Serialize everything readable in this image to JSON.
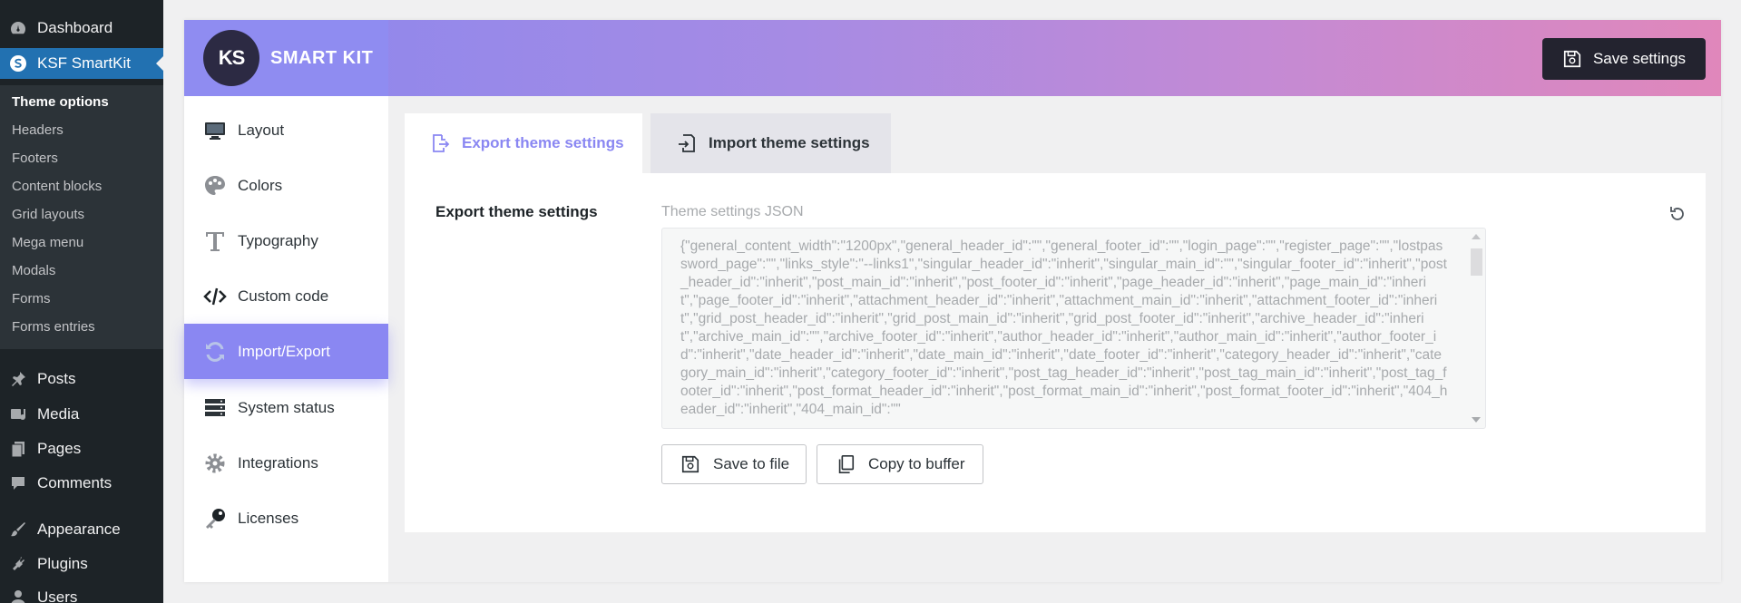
{
  "wp_menu": {
    "dashboard": "Dashboard",
    "smartkit": "KSF SmartKit",
    "submenu": [
      "Theme options",
      "Headers",
      "Footers",
      "Content blocks",
      "Grid layouts",
      "Mega menu",
      "Modals",
      "Forms",
      "Forms entries"
    ],
    "posts": "Posts",
    "media": "Media",
    "pages": "Pages",
    "comments": "Comments",
    "appearance": "Appearance",
    "plugins": "Plugins",
    "users": "Users"
  },
  "brand": {
    "logo": "KS",
    "name": "SMART KIT"
  },
  "header": {
    "save_label": "Save settings"
  },
  "nav": {
    "items": [
      "Layout",
      "Colors",
      "Typography",
      "Custom code",
      "Import/Export",
      "System status",
      "Integrations",
      "Licenses"
    ],
    "active": "Import/Export"
  },
  "tabs": {
    "export": "Export theme settings",
    "import": "Import theme settings"
  },
  "export_section": {
    "label": "Export theme settings",
    "json_label": "Theme settings JSON",
    "json_value": "{\"general_content_width\":\"1200px\",\"general_header_id\":\"\",\"general_footer_id\":\"\",\"login_page\":\"\",\"register_page\":\"\",\"lostpassword_page\":\"\",\"links_style\":\"--links1\",\"singular_header_id\":\"inherit\",\"singular_main_id\":\"\",\"singular_footer_id\":\"inherit\",\"post_header_id\":\"inherit\",\"post_main_id\":\"inherit\",\"post_footer_id\":\"inherit\",\"page_header_id\":\"inherit\",\"page_main_id\":\"inherit\",\"page_footer_id\":\"inherit\",\"attachment_header_id\":\"inherit\",\"attachment_main_id\":\"inherit\",\"attachment_footer_id\":\"inherit\",\"grid_post_header_id\":\"inherit\",\"grid_post_main_id\":\"inherit\",\"grid_post_footer_id\":\"inherit\",\"archive_header_id\":\"inherit\",\"archive_main_id\":\"\",\"archive_footer_id\":\"inherit\",\"author_header_id\":\"inherit\",\"author_main_id\":\"inherit\",\"author_footer_id\":\"inherit\",\"date_header_id\":\"inherit\",\"date_main_id\":\"inherit\",\"date_footer_id\":\"inherit\",\"category_header_id\":\"inherit\",\"category_main_id\":\"inherit\",\"category_footer_id\":\"inherit\",\"post_tag_header_id\":\"inherit\",\"post_tag_main_id\":\"inherit\",\"post_tag_footer_id\":\"inherit\",\"post_format_header_id\":\"inherit\",\"post_format_main_id\":\"inherit\",\"post_format_footer_id\":\"inherit\",\"404_header_id\":\"inherit\",\"404_main_id\":\"\"",
    "save_file": "Save to file",
    "copy_buffer": "Copy to buffer"
  },
  "colors": {
    "accent": "#8a87f2",
    "wp_active": "#2271b1",
    "wp_bg": "#1d2327",
    "dark_button": "#23232f"
  }
}
